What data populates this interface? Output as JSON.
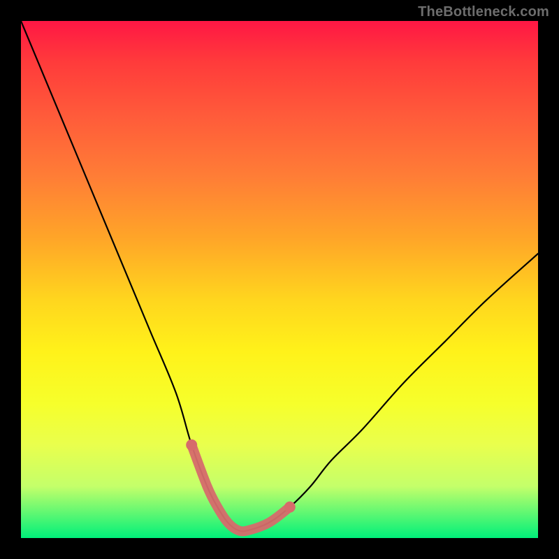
{
  "watermark": "TheBottleneck.com",
  "chart_data": {
    "type": "line",
    "title": "",
    "xlabel": "",
    "ylabel": "",
    "xlim": [
      0,
      100
    ],
    "ylim": [
      0,
      100
    ],
    "series": [
      {
        "name": "bottleneck-curve",
        "x": [
          0,
          5,
          10,
          15,
          20,
          25,
          30,
          33,
          36,
          38,
          40,
          42,
          44,
          48,
          52,
          56,
          60,
          66,
          74,
          82,
          90,
          100
        ],
        "values": [
          100,
          88,
          76,
          64,
          52,
          40,
          28,
          18,
          10,
          6,
          3,
          1.5,
          1.5,
          3,
          6,
          10,
          15,
          21,
          30,
          38,
          46,
          55
        ]
      },
      {
        "name": "bottom-highlight",
        "x": [
          33,
          36,
          38,
          40,
          42,
          44,
          48,
          52
        ],
        "values": [
          18,
          10,
          6,
          3,
          1.5,
          1.5,
          3,
          6
        ]
      }
    ],
    "highlight_color": "#d66b6b",
    "curve_color": "#000000"
  }
}
